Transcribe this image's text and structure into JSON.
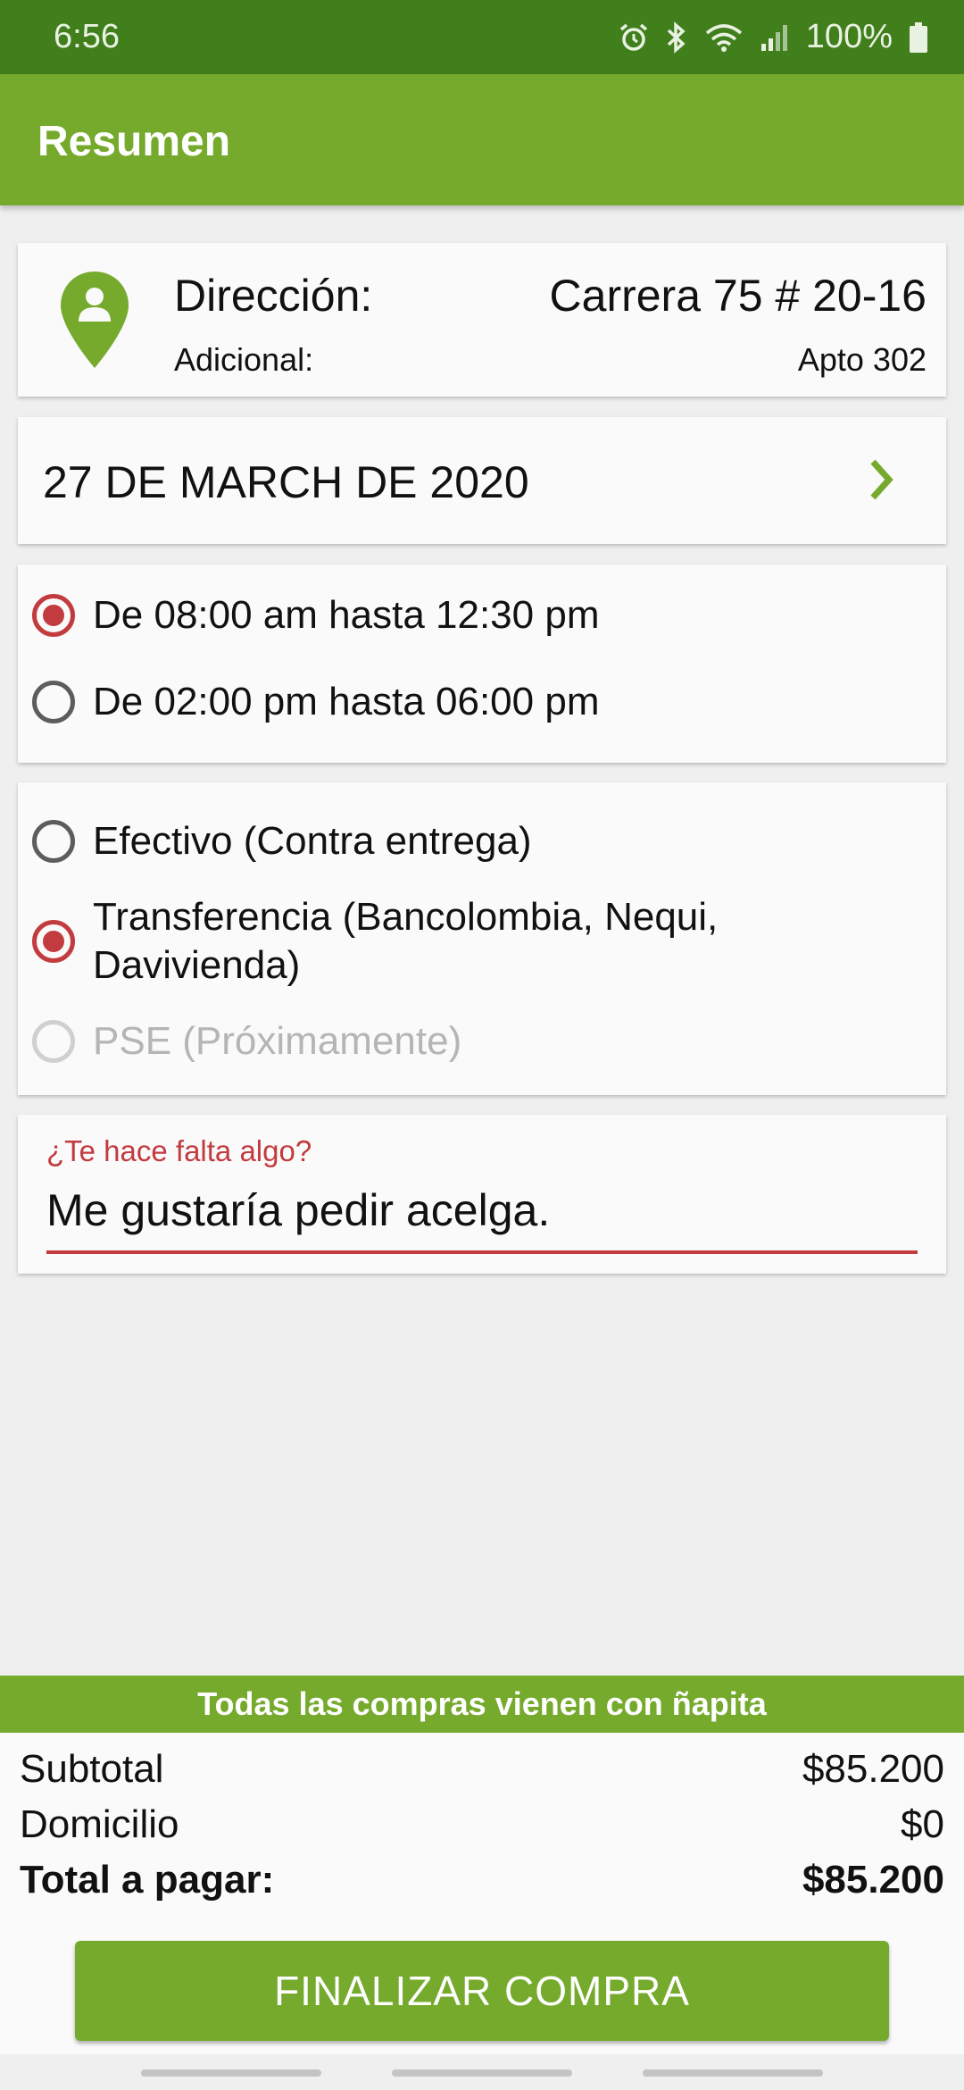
{
  "status_bar": {
    "time": "6:56",
    "battery": "100%"
  },
  "app_bar": {
    "title": "Resumen"
  },
  "address": {
    "label": "Dirección:",
    "value": "Carrera 75 # 20-16",
    "additional_label": "Adicional:",
    "additional_value": "Apto 302"
  },
  "date": {
    "text": "27 DE MARCH DE 2020"
  },
  "time_slots": [
    {
      "label": "De 08:00 am hasta 12:30 pm",
      "selected": true
    },
    {
      "label": "De 02:00 pm hasta 06:00 pm",
      "selected": false
    }
  ],
  "payment_methods": [
    {
      "label": "Efectivo (Contra entrega)",
      "selected": false
    },
    {
      "label": "Transferencia (Bancolombia, Nequi, Davivienda)",
      "selected": true
    },
    {
      "label": "PSE (Próximamente)",
      "selected": false,
      "disabled": true
    }
  ],
  "note": {
    "label": "¿Te hace falta algo?",
    "value": "Me gustaría pedir acelga."
  },
  "banner": {
    "text": "Todas las compras vienen con ñapita"
  },
  "summary": {
    "subtotal_label": "Subtotal",
    "subtotal_value": "$85.200",
    "delivery_label": "Domicilio",
    "delivery_value": "$0",
    "total_label": "Total a pagar:",
    "total_value": "$85.200"
  },
  "finish_button": {
    "label": "FINALIZAR COMPRA"
  },
  "colors": {
    "primary": "#75aa2d",
    "status_bar": "#417e1c",
    "accent": "#c23b3f"
  }
}
